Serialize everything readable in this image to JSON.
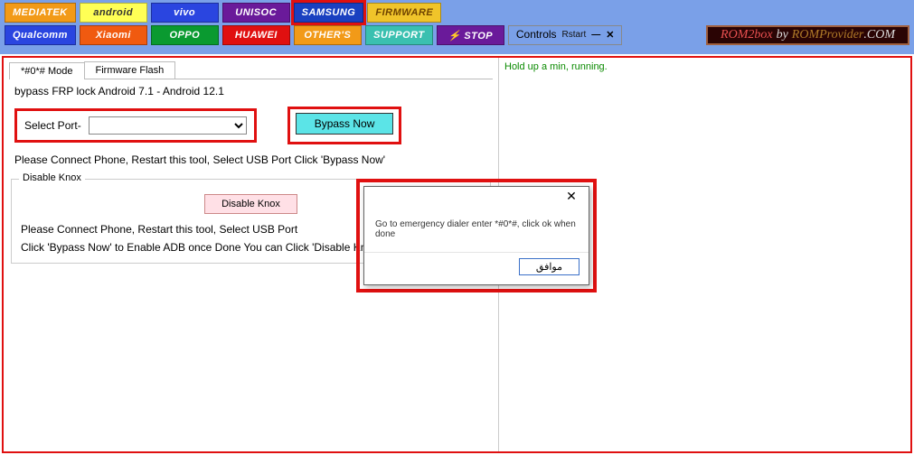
{
  "header": {
    "row1": [
      {
        "label": "MEDIATEK",
        "bg": "#f29a18",
        "fg": "#ffffff"
      },
      {
        "label": "android",
        "bg": "#ffff55",
        "fg": "#333333"
      },
      {
        "label": "vivo",
        "bg": "#2a45e0",
        "fg": "#ffffff"
      },
      {
        "label": "UNISOC",
        "bg": "#6a1a9a",
        "fg": "#ffffff"
      },
      {
        "label": "SAMSUNG",
        "bg": "#1a40c0",
        "fg": "#ffffff",
        "selected": true
      },
      {
        "label": "FIRMWARE",
        "bg": "#f0c42a",
        "fg": "#704400"
      }
    ],
    "row2": [
      {
        "label": "Qualcomm",
        "bg": "#2a45e0",
        "fg": "#ffffff"
      },
      {
        "label": "Xiaomi",
        "bg": "#f05a10",
        "fg": "#ffffff"
      },
      {
        "label": "OPPO",
        "bg": "#0a9a30",
        "fg": "#ffffff"
      },
      {
        "label": "HUAWEI",
        "bg": "#e01010",
        "fg": "#ffffff"
      },
      {
        "label": "OTHER'S",
        "bg": "#f29a18",
        "fg": "#ffffff"
      },
      {
        "label": "SUPPORT",
        "bg": "#3ac0b0",
        "fg": "#ffffff"
      },
      {
        "label": "⚡ STOP",
        "bg": "#6a1a9a",
        "fg": "#ffffff"
      }
    ],
    "controls": {
      "legend": "Controls",
      "label": "Rstart",
      "icons": [
        "minus",
        "x"
      ]
    },
    "banner": {
      "brand": "ROM2box",
      "by": "by",
      "provider": "ROMProvider",
      "com": ".COM"
    }
  },
  "tabs": [
    {
      "label": "*#0*# Mode",
      "active": true
    },
    {
      "label": "Firmware Flash",
      "active": false
    }
  ],
  "frp": {
    "title": "bypass FRP lock Android 7.1 - Android 12.1",
    "port_label": "Select Port-",
    "port_value": "",
    "bypass_label": "Bypass Now",
    "help": "Please Connect Phone, Restart this tool, Select USB Port Click 'Bypass Now'"
  },
  "knox": {
    "group_title": "Disable Knox",
    "button_label": "Disable Knox",
    "help1": "Please Connect Phone, Restart this tool, Select USB Port",
    "help2": "Click 'Bypass Now' to Enable ADB once Done You can Click 'Disable Knox'"
  },
  "log": {
    "status": "Hold up a min, running."
  },
  "dialog": {
    "message": "Go to emergency dialer enter *#0*#, click ok when done",
    "ok_label": "موافق"
  }
}
